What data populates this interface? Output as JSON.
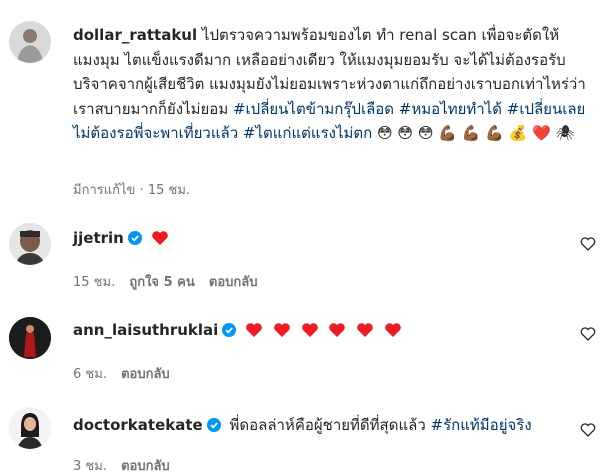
{
  "post": {
    "username": "dollar_rattakul",
    "caption_text": "ไปตรวจความพร้อมของไต ทำ renal scan เพื่อจะตัดให้แมงมุม ไตแข็งแรงดีมาก เหลืออย่างเดียว ให้แมงมุมยอมรับ จะได้ไม่ต้องรอรับบริจาคจากผู้เสียชีวิต แมงมุมยังไม่ยอมเพราะห่วงตาแก่ถึกอย่างเราบอกเท่าไหร่ว่าเราสบายมากก็ยังไม่ยอม",
    "hashtags": [
      "#เปลี่ยนไตข้ามกรุ๊ปเลือด",
      "#หมอไทยทำได้",
      "#เปลี่ยนเลยไม่ต้องรอพี่จะพาเที่ยวแล้ว",
      "#ไตแก่แต่แรงไม่ตก"
    ],
    "emojis": "😳 😳 😳 💪🏾 💪🏾 💪🏾 💰 ❤️ 🕷",
    "edited_label": "มีการแก้ไข",
    "time": "15 ชม."
  },
  "comments": [
    {
      "username": "jjetrin",
      "verified": true,
      "text": "",
      "hearts": 1,
      "time": "15 ชม.",
      "likes": "ถูกใจ 5 คน",
      "reply": "ตอบกลับ"
    },
    {
      "username": "ann_laisuthruklai",
      "verified": true,
      "text": "",
      "hearts": 6,
      "time": "6 ชม.",
      "likes": "",
      "reply": "ตอบกลับ"
    },
    {
      "username": "doctorkatekate",
      "verified": true,
      "text": "พี่ดอลล่าห์คือผู้ชายที่ดีที่สุดแล้ว",
      "hashtag": "#รักแท้มีอยู่จริง",
      "time": "3 ชม.",
      "likes": "",
      "reply": "ตอบกลับ"
    }
  ],
  "colors": {
    "text": "#262626",
    "muted": "#737373",
    "link": "#00376b",
    "heart": "#ed1c24",
    "verified": "#0095f6"
  }
}
